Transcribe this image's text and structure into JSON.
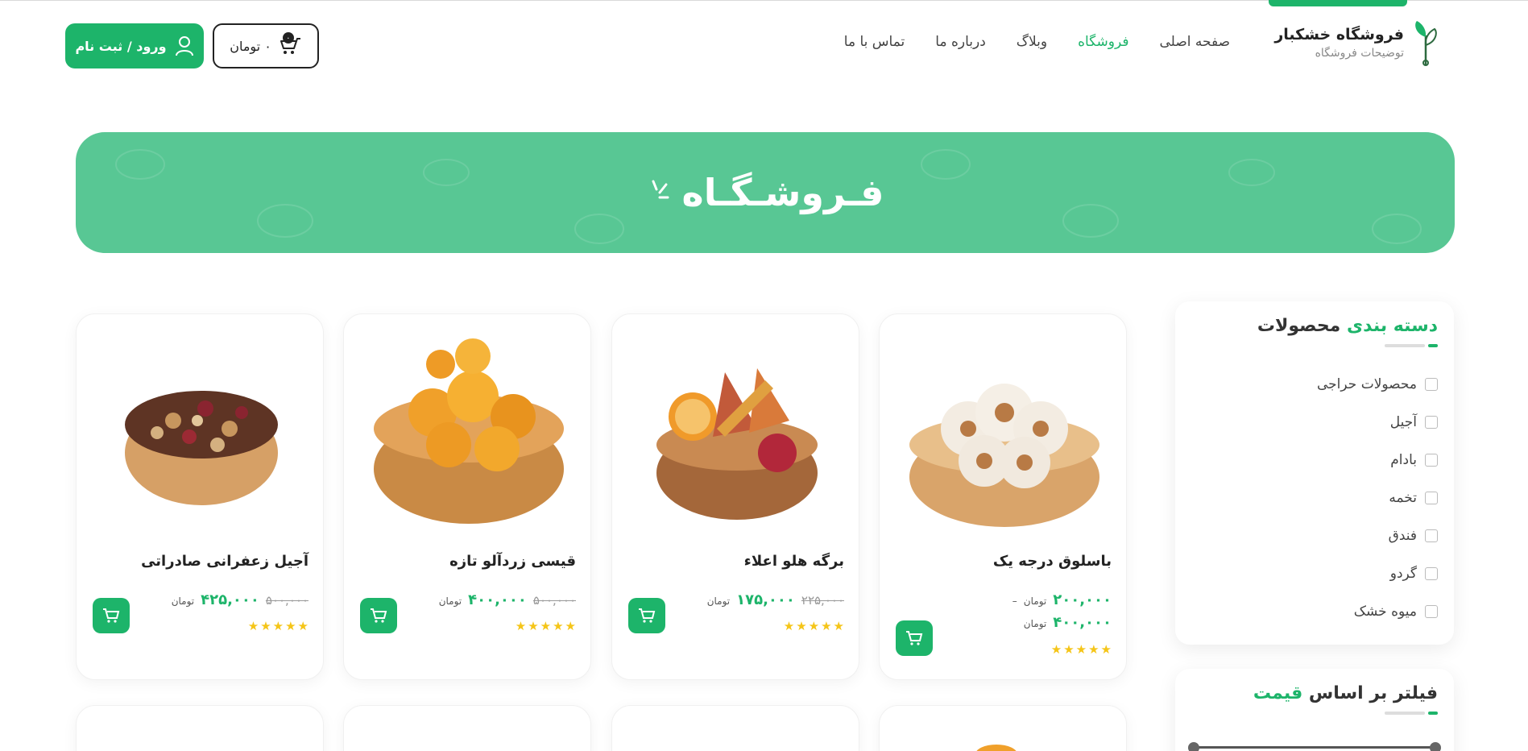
{
  "header": {
    "logo_title": "فروشگاه خشکبار",
    "logo_subtitle": "توضیحات فروشگاه",
    "nav": [
      {
        "label": "صفحه اصلی",
        "active": false
      },
      {
        "label": "فروشگاه",
        "active": true
      },
      {
        "label": "وبلاگ",
        "active": false
      },
      {
        "label": "درباره ما",
        "active": false
      },
      {
        "label": "تماس با ما",
        "active": false
      }
    ],
    "cart_label": "۰ تومان",
    "cart_count": "۰",
    "login_label": "ورود / ثبت نام"
  },
  "banner": {
    "title": "فـروشـگـاه"
  },
  "sidebar": {
    "categories": {
      "title_accent": "دسته بندی",
      "title_rest": " محصولات",
      "items": [
        "محصولات حراجی",
        "آجیل",
        "بادام",
        "تخمه",
        "فندق",
        "گردو",
        "میوه خشک"
      ]
    },
    "filter": {
      "title_rest": "فیلتر بر اساس ",
      "title_accent": "قیمت"
    }
  },
  "products": [
    {
      "name": "باسلوق درجه یک",
      "price_range": true,
      "price_min": "۲۰۰,۰۰۰",
      "price_max": "۴۰۰,۰۰۰",
      "unit": "تومان",
      "range_sep": "–",
      "stars": 5
    },
    {
      "name": "برگه هلو اعلاء",
      "price_old": "۲۲۵,۰۰۰",
      "price_new": "۱۷۵,۰۰۰",
      "unit": "تومان",
      "stars": 5
    },
    {
      "name": "قیسی زردآلو تازه",
      "price_old": "۵۰۰,۰۰۰",
      "price_new": "۴۰۰,۰۰۰",
      "unit": "تومان",
      "stars": 5
    },
    {
      "name": "آجیل زعفرانی صادراتی",
      "price_old": "۵۰۰,۰۰۰",
      "price_new": "۴۲۵,۰۰۰",
      "unit": "تومان",
      "stars": 5
    }
  ],
  "colors": {
    "brand": "#1db46a",
    "banner": "#58c794",
    "star": "#f5c518"
  }
}
